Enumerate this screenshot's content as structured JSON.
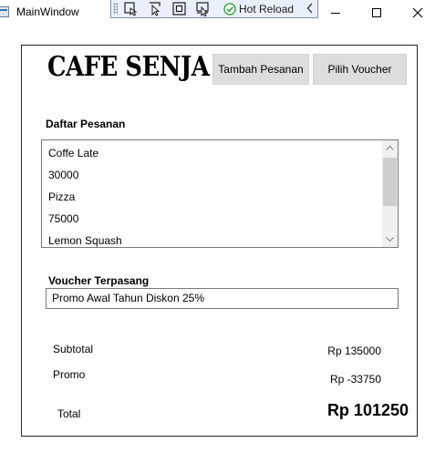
{
  "window": {
    "title": "MainWindow",
    "icon": "window-app-icon"
  },
  "hot_reload_toolbar": {
    "label": "Hot Reload",
    "tools": [
      "select-element-icon",
      "select-pointer-icon",
      "layout-adorner-icon",
      "track-focus-icon"
    ],
    "status_icon": "check-circle-icon",
    "collapse_icon": "chevron-left-icon"
  },
  "window_controls": [
    "minimize-icon",
    "maximize-icon",
    "close-icon"
  ],
  "app": {
    "title": "CAFE SENJA",
    "buttons": {
      "tambah_pesanan": "Tambah Pesanan",
      "pilih_voucher": "Pilih Voucher"
    },
    "daftar_pesanan": {
      "label": "Daftar Pesanan",
      "items": [
        "Coffe Late",
        "30000",
        "Pizza",
        "75000",
        "Lemon Squash"
      ]
    },
    "voucher": {
      "label": "Voucher Terpasang",
      "value": "Promo Awal Tahun Diskon 25%"
    },
    "summary": {
      "subtotal_label": "Subtotal",
      "subtotal_value": "Rp 135000",
      "promo_label": "Promo",
      "promo_value": "Rp -33750",
      "total_label": "Total",
      "total_value": "Rp 101250"
    }
  },
  "colors": {
    "toolbar_bg": "#eaf0fb",
    "toolbar_border": "#7a8fb4",
    "hot_reload_green": "#2e9d32",
    "button_bg": "#dddddd",
    "scroll_thumb": "#cdcdcd"
  }
}
